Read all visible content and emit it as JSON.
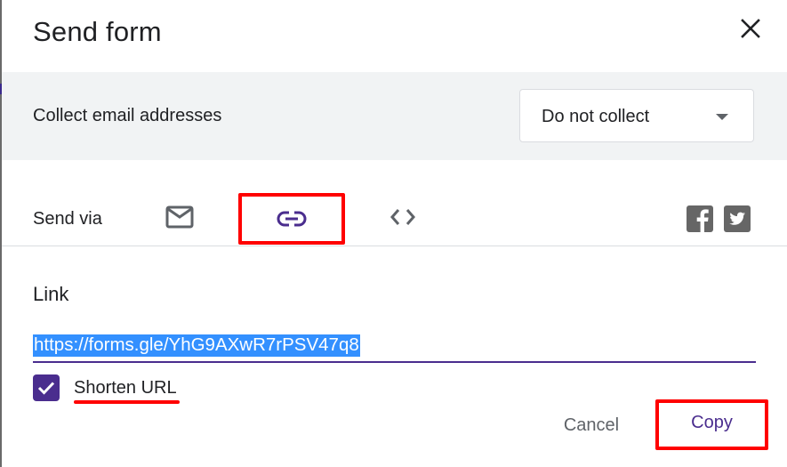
{
  "dialog": {
    "title": "Send form",
    "close_icon": "close-icon"
  },
  "collect_email": {
    "label": "Collect email addresses",
    "selected_option": "Do not collect",
    "dropdown_icon": "caret-down-icon"
  },
  "send_via": {
    "label": "Send via",
    "tabs": [
      {
        "name": "email",
        "icon": "mail-icon",
        "active": false
      },
      {
        "name": "link",
        "icon": "link-icon",
        "active": true
      },
      {
        "name": "embed",
        "icon": "code-icon",
        "active": false
      }
    ],
    "social": [
      {
        "name": "facebook",
        "icon": "facebook-icon"
      },
      {
        "name": "twitter",
        "icon": "twitter-icon"
      }
    ]
  },
  "link_section": {
    "heading": "Link",
    "url": "https://forms.gle/YhG9AXwR7rPSV47q8",
    "shorten_url_label": "Shorten URL",
    "shorten_url_checked": true
  },
  "actions": {
    "cancel_label": "Cancel",
    "copy_label": "Copy"
  },
  "colors": {
    "accent": "#4a2d8e",
    "highlight_box": "#ff0000",
    "selection": "#3390ff",
    "band_bg": "#f1f3f4",
    "icon_gray": "#5f6368"
  }
}
